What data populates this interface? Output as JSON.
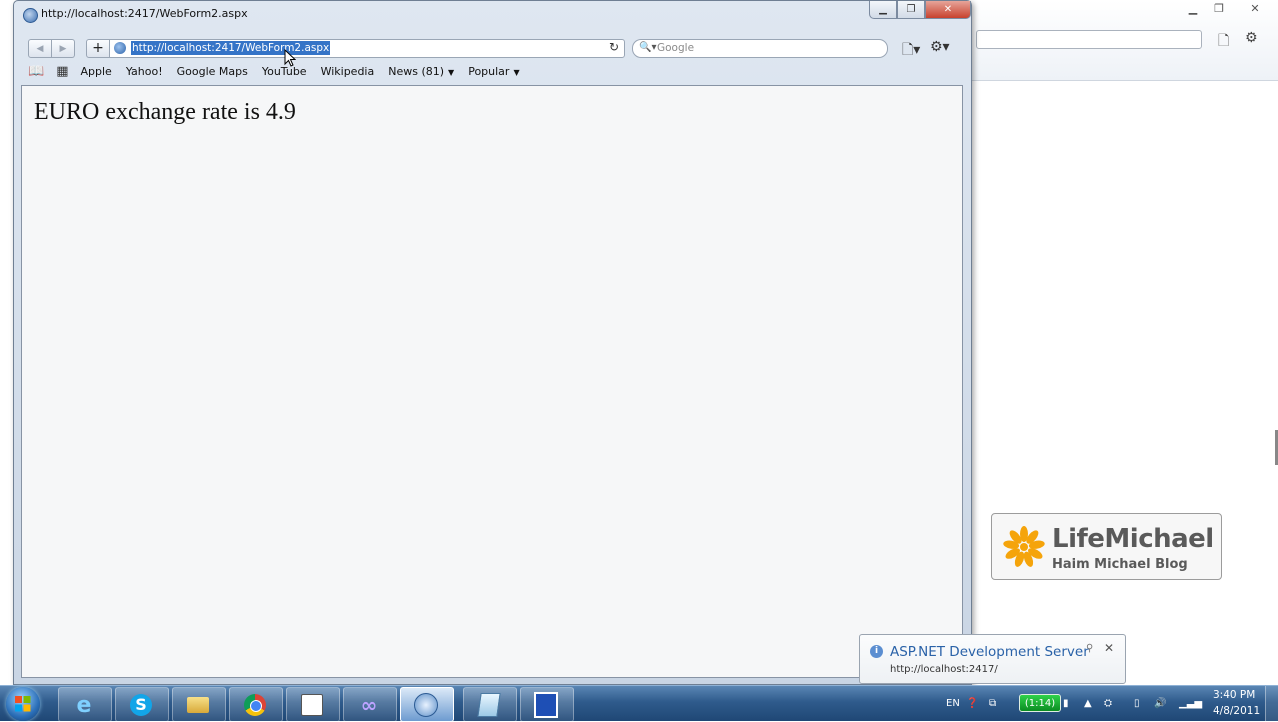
{
  "browser": {
    "title": "http://localhost:2417/WebForm2.aspx",
    "address": "http://localhost:2417/WebForm2.aspx",
    "search_placeholder": "Google",
    "bookmarks": [
      "Apple",
      "Yahoo!",
      "Google Maps",
      "YouTube",
      "Wikipedia",
      "News (81)",
      "Popular"
    ]
  },
  "page": {
    "heading": "EURO exchange rate is 4.9"
  },
  "logo": {
    "name": "LifeMichael",
    "subtitle": "Haim Michael Blog"
  },
  "notification": {
    "title": "ASP.NET Development Server",
    "url": "http://localhost:2417/"
  },
  "taskbar": {
    "language": "EN",
    "battery": "(1:14)",
    "time": "3:40 PM",
    "date": "4/8/2011"
  },
  "colors": {
    "selection": "#3574c7",
    "taskbar": "#2f5b8c",
    "logo_orange": "#f5a40b"
  }
}
